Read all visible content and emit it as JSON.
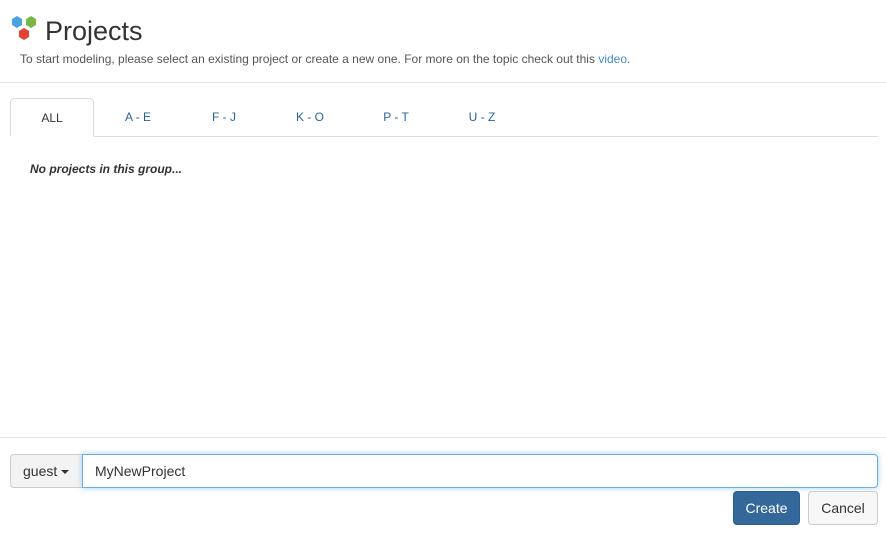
{
  "header": {
    "title": "Projects",
    "subtitle_text": "To start modeling, please select an existing project or create a new one. For more on the topic check out this ",
    "subtitle_link": "video",
    "subtitle_end": ".",
    "logo_icon": "hexagon-cluster-logo",
    "colors": {
      "blue": "#4aa3df",
      "green": "#7ab648",
      "red": "#e2452f"
    }
  },
  "tabs": [
    {
      "label": "ALL",
      "active": true
    },
    {
      "label": "A - E",
      "active": false
    },
    {
      "label": "F - J",
      "active": false
    },
    {
      "label": "K - O",
      "active": false
    },
    {
      "label": "P - T",
      "active": false
    },
    {
      "label": "U - Z",
      "active": false
    }
  ],
  "main": {
    "empty_message": "No projects in this group..."
  },
  "footer": {
    "user_label": "guest",
    "project_name_value": "MyNewProject",
    "create_label": "Create",
    "cancel_label": "Cancel",
    "accent": "#34679a"
  }
}
